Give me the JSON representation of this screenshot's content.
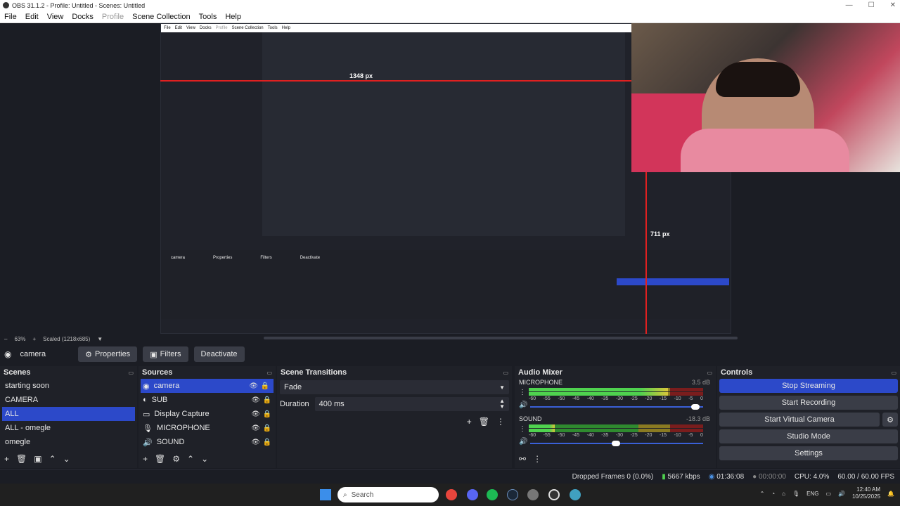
{
  "window": {
    "title": "OBS 31.1.2 - Profile: Untitled - Scenes: Untitled",
    "minimize": "—",
    "maximize": "☐",
    "close": "✕"
  },
  "menu": [
    "File",
    "Edit",
    "View",
    "Docks",
    "Profile",
    "Scene Collection",
    "Tools",
    "Help"
  ],
  "preview": {
    "measure_h": "1348 px",
    "measure_v": "711 px",
    "nested_menu": [
      "File",
      "Edit",
      "View",
      "Docks",
      "Profile",
      "Scene Collection",
      "Tools",
      "Help"
    ],
    "nested_source": "camera",
    "nested_btns": [
      "Properties",
      "Filters",
      "Deactivate"
    ]
  },
  "scale": {
    "minus": "–",
    "zoom": "63%",
    "plus": "+",
    "mode": "Scaled (1218x685)"
  },
  "source_toolbar": {
    "name": "camera",
    "properties": "Properties",
    "filters": "Filters",
    "deactivate": "Deactivate"
  },
  "scenes": {
    "title": "Scenes",
    "items": [
      "starting soon",
      "CAMERA",
      "ALL",
      "ALL - omegle",
      "omegle"
    ],
    "selected": 2
  },
  "sources": {
    "title": "Sources",
    "items": [
      {
        "name": "camera",
        "icon": "camera-icon"
      },
      {
        "name": "SUB",
        "icon": "browser-icon"
      },
      {
        "name": "Display Capture",
        "icon": "monitor-icon"
      },
      {
        "name": "MICROPHONE",
        "icon": "microphone-icon"
      },
      {
        "name": "SOUND",
        "icon": "speaker-icon"
      }
    ],
    "selected": 0
  },
  "transitions": {
    "title": "Scene Transitions",
    "type": "Fade",
    "duration_label": "Duration",
    "duration": "400 ms"
  },
  "mixer": {
    "title": "Audio Mixer",
    "ticks": [
      "-60",
      "-55",
      "-50",
      "-45",
      "-40",
      "-35",
      "-30",
      "-25",
      "-20",
      "-15",
      "-10",
      "-5",
      "0"
    ],
    "channels": [
      {
        "name": "MICROPHONE",
        "db": "3.5 dB",
        "level": 0.8,
        "volume": 0.98
      },
      {
        "name": "SOUND",
        "db": "-18.3 dB",
        "level": 0.15,
        "volume": 0.52
      }
    ]
  },
  "controls": {
    "title": "Controls",
    "stop_streaming": "Stop Streaming",
    "start_recording": "Start Recording",
    "start_virtual_camera": "Start Virtual Camera",
    "studio_mode": "Studio Mode",
    "settings": "Settings"
  },
  "status": {
    "dropped": "Dropped Frames 0 (0.0%)",
    "kbps": "5667 kbps",
    "stream_time": "01:36:08",
    "rec_time": "00:00:00",
    "cpu": "CPU: 4.0%",
    "fps": "60.00 / 60.00 FPS"
  },
  "taskbar": {
    "search": "Search",
    "lang": "ENG",
    "time": "12:40 AM",
    "date": "10/25/2025"
  },
  "colors": {
    "accent": "#2c49c9",
    "background": "#1b1d24",
    "panel": "#1f2128",
    "red_guide": "#e02020"
  }
}
